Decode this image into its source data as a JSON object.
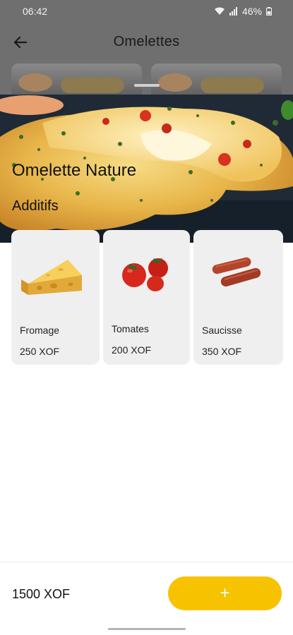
{
  "status_bar": {
    "time": "06:42",
    "battery": "46%"
  },
  "app_bar": {
    "title": "Omelettes"
  },
  "product": {
    "name": "Omelette Nature"
  },
  "addons": {
    "title": "Additifs",
    "items": [
      {
        "name": "Fromage",
        "price": "250 XOF",
        "icon": "cheese-image"
      },
      {
        "name": "Tomates",
        "price": "200 XOF",
        "icon": "tomato-image"
      },
      {
        "name": "Saucisse",
        "price": "350 XOF",
        "icon": "sausage-image"
      }
    ]
  },
  "footer": {
    "total": "1500 XOF",
    "add_label": "+"
  },
  "colors": {
    "accent": "#f7c200",
    "card": "#efefef",
    "scrim": "#6f6f6f"
  }
}
